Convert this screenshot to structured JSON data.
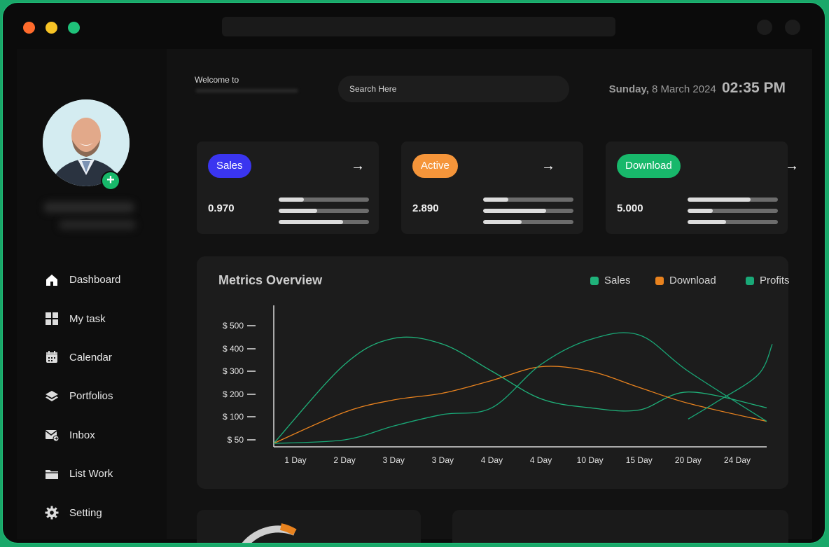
{
  "window": {
    "controls": [
      "close",
      "minimize",
      "maximize"
    ]
  },
  "header": {
    "welcome": "Welcome to",
    "search_placeholder": "Search Here",
    "day": "Sunday,",
    "date": "8 March 2024",
    "time": "02:35 PM"
  },
  "sidebar": {
    "items": [
      {
        "label": "Dashboard",
        "icon": "home-icon"
      },
      {
        "label": "My task",
        "icon": "grid-icon"
      },
      {
        "label": "Calendar",
        "icon": "calendar-icon"
      },
      {
        "label": "Portfolios",
        "icon": "layers-icon"
      },
      {
        "label": "Inbox",
        "icon": "mail-icon"
      },
      {
        "label": "List Work",
        "icon": "folder-icon"
      },
      {
        "label": "Setting",
        "icon": "gear-icon"
      }
    ]
  },
  "cards": [
    {
      "label": "Sales",
      "value": "0.970",
      "color": "#3a35f0",
      "bars": [
        0.28,
        0.43,
        0.71
      ]
    },
    {
      "label": "Active",
      "value": "2.890",
      "color": "#f5953a",
      "bars": [
        0.28,
        0.7,
        0.43
      ]
    },
    {
      "label": "Download",
      "value": "5.000",
      "color": "#18b86b",
      "bars": [
        0.7,
        0.28,
        0.43
      ]
    }
  ],
  "chart": {
    "title": "Metrics Overview"
  },
  "chart_data": {
    "type": "line",
    "categories": [
      "1 Day",
      "2 Day",
      "3 Day",
      "3 Day",
      "4 Day",
      "4 Day",
      "10 Day",
      "15 Day",
      "20 Day",
      "24 Day"
    ],
    "y_ticks": [
      "$ 50",
      "$ 100",
      "$ 200",
      "$ 300",
      "$ 400",
      "$ 500"
    ],
    "series": [
      {
        "name": "Sales",
        "color": "#1fb27a",
        "values": [
          25,
          330,
          445,
          420,
          300,
          180,
          140,
          130,
          210,
          140
        ]
      },
      {
        "name": "Download",
        "color": "#e8821e",
        "values": [
          25,
          120,
          175,
          205,
          260,
          320,
          300,
          230,
          160,
          90
        ]
      },
      {
        "name": "Profits",
        "color": "#19a877",
        "values": [
          25,
          50,
          80,
          110,
          140,
          330,
          440,
          460,
          300,
          90
        ]
      }
    ],
    "extra_series": {
      "color": "#19a877",
      "values": [
        95,
        165,
        285,
        420
      ]
    }
  }
}
